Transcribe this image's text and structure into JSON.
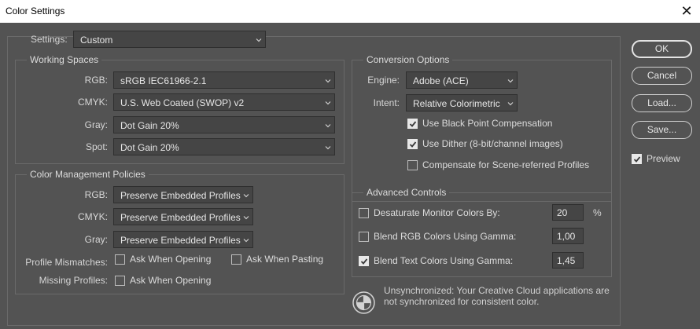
{
  "window": {
    "title": "Color Settings",
    "close_glyph": "✕"
  },
  "settings": {
    "label": "Settings:",
    "value": "Custom"
  },
  "working_spaces": {
    "title": "Working Spaces",
    "rgb": {
      "label": "RGB:",
      "value": "sRGB IEC61966-2.1"
    },
    "cmyk": {
      "label": "CMYK:",
      "value": "U.S. Web Coated (SWOP) v2"
    },
    "gray": {
      "label": "Gray:",
      "value": "Dot Gain 20%"
    },
    "spot": {
      "label": "Spot:",
      "value": "Dot Gain 20%"
    }
  },
  "policies": {
    "title": "Color Management Policies",
    "rgb": {
      "label": "RGB:",
      "value": "Preserve Embedded Profiles"
    },
    "cmyk": {
      "label": "CMYK:",
      "value": "Preserve Embedded Profiles"
    },
    "gray": {
      "label": "Gray:",
      "value": "Preserve Embedded Profiles"
    },
    "profile_mismatches": {
      "label": "Profile Mismatches:",
      "ask_opening": {
        "label": "Ask When Opening",
        "checked": false
      },
      "ask_pasting": {
        "label": "Ask When Pasting",
        "checked": false
      }
    },
    "missing_profiles": {
      "label": "Missing Profiles:",
      "ask_opening": {
        "label": "Ask When Opening",
        "checked": false
      }
    }
  },
  "conversion": {
    "title": "Conversion Options",
    "engine": {
      "label": "Engine:",
      "value": "Adobe (ACE)"
    },
    "intent": {
      "label": "Intent:",
      "value": "Relative Colorimetric"
    },
    "black_point": {
      "label": "Use Black Point Compensation",
      "checked": true
    },
    "dither": {
      "label": "Use Dither (8-bit/channel images)",
      "checked": true
    },
    "scene_referred": {
      "label": "Compensate for Scene-referred Profiles",
      "checked": false
    }
  },
  "advanced": {
    "title": "Advanced Controls",
    "desaturate": {
      "label": "Desaturate Monitor Colors By:",
      "value": "20",
      "unit": "%",
      "checked": false
    },
    "blend_rgb": {
      "label": "Blend RGB Colors Using Gamma:",
      "value": "1,00",
      "checked": false
    },
    "blend_text": {
      "label": "Blend Text Colors Using Gamma:",
      "value": "1,45",
      "checked": true
    }
  },
  "sync": {
    "icon": "sync-status-icon",
    "message": "Unsynchronized: Your Creative Cloud applications are not synchronized for consistent color."
  },
  "buttons": {
    "ok": "OK",
    "cancel": "Cancel",
    "load": "Load...",
    "save": "Save..."
  },
  "preview": {
    "label": "Preview",
    "checked": true
  }
}
